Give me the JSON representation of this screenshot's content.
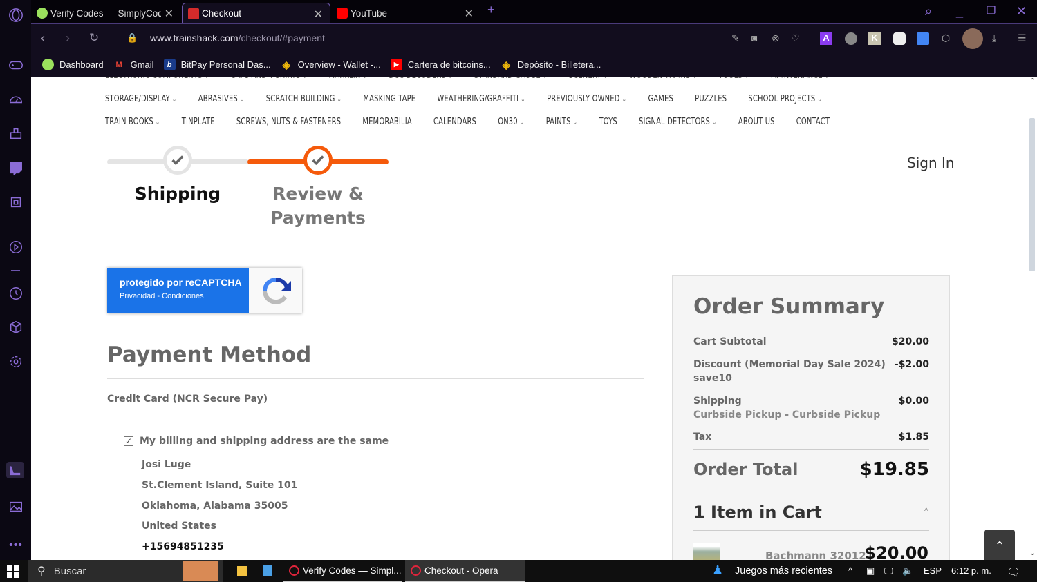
{
  "browser": {
    "tabs": [
      {
        "title": "Verify Codes — SimplyCodes",
        "active": false
      },
      {
        "title": "Checkout",
        "active": true
      },
      {
        "title": "YouTube",
        "active": false
      }
    ],
    "url_domain": "www.trainshack.com",
    "url_path": "/checkout/#payment",
    "bookmarks": [
      {
        "label": "Dashboard",
        "icon": "simplycodes-icon"
      },
      {
        "label": "Gmail",
        "icon": "gmail-icon"
      },
      {
        "label": "BitPay Personal Das...",
        "icon": "bitpay-icon"
      },
      {
        "label": "Overview - Wallet -...",
        "icon": "binance-icon"
      },
      {
        "label": "Cartera de bitcoins...",
        "icon": "youtube-icon"
      },
      {
        "label": "Depósito - Billetera...",
        "icon": "binance-icon"
      }
    ]
  },
  "menu": {
    "row0": [
      "ELECTRONIC COMPONENTS",
      "CAPS AND T-SHIRTS",
      "MARKLIN",
      "DCC DECODERS",
      "STANDARD GAUGE",
      "SCENERY",
      "WOODEN TRAINS",
      "TOOLS",
      "MAINTENANCE"
    ],
    "row1": [
      {
        "label": "STORAGE/DISPLAY",
        "dropdown": true
      },
      {
        "label": "ABRASIVES",
        "dropdown": true
      },
      {
        "label": "SCRATCH BUILDING",
        "dropdown": true
      },
      {
        "label": "MASKING TAPE",
        "dropdown": false
      },
      {
        "label": "WEATHERING/GRAFFITI",
        "dropdown": true
      },
      {
        "label": "PREVIOUSLY OWNED",
        "dropdown": true
      },
      {
        "label": "GAMES",
        "dropdown": false
      },
      {
        "label": "PUZZLES",
        "dropdown": false
      },
      {
        "label": "SCHOOL PROJECTS",
        "dropdown": true
      }
    ],
    "row2": [
      {
        "label": "TRAIN BOOKS",
        "dropdown": true
      },
      {
        "label": "TINPLATE",
        "dropdown": false
      },
      {
        "label": "SCREWS, NUTS & FASTENERS",
        "dropdown": false
      },
      {
        "label": "MEMORABILIA",
        "dropdown": false
      },
      {
        "label": "CALENDARS",
        "dropdown": false
      },
      {
        "label": "ON30",
        "dropdown": true
      },
      {
        "label": "PAINTS",
        "dropdown": true
      },
      {
        "label": "TOYS",
        "dropdown": false
      },
      {
        "label": "SIGNAL DETECTORS",
        "dropdown": true
      },
      {
        "label": "ABOUT US",
        "dropdown": false
      },
      {
        "label": "CONTACT",
        "dropdown": false
      }
    ]
  },
  "checkout": {
    "steps": [
      {
        "label": "Shipping",
        "state": "complete"
      },
      {
        "label": "Review & Payments",
        "state": "current"
      }
    ],
    "accent_color": "#f55a0b",
    "sign_in": "Sign In",
    "recaptcha": {
      "title": "protegido por reCAPTCHA",
      "links": "Privacidad - Condiciones"
    },
    "payment_method_title": "Payment Method",
    "payment_option": "Credit Card (NCR Secure Pay)",
    "same_address_label": "My billing and shipping address are the same",
    "same_address_checked": true,
    "address": {
      "name": "Josi Luge",
      "street": "St.Clement Island, Suite 101",
      "city_line": "Oklahoma, Alabama 35005",
      "country": "United States",
      "phone": "+15694851235"
    }
  },
  "summary": {
    "title": "Order Summary",
    "subtotal_label": "Cart Subtotal",
    "subtotal": "$20.00",
    "discount_label": "Discount (Memorial Day Sale 2024)",
    "discount_code": "save10",
    "discount": "-$2.00",
    "shipping_label": "Shipping",
    "shipping_method": "Curbside Pickup - Curbside Pickup",
    "shipping": "$0.00",
    "tax_label": "Tax",
    "tax": "$1.85",
    "total_label": "Order Total",
    "total": "$19.85",
    "items_label": "1 Item in Cart",
    "item": {
      "name": "Bachmann 32012",
      "price": "$20.00"
    }
  },
  "taskbar": {
    "search": "Buscar",
    "apps": [
      "Verify Codes — Simpl...",
      "Checkout - Opera"
    ],
    "news": "Juegos más recientes",
    "lang": "ESP",
    "time": "6:12 p. m."
  }
}
